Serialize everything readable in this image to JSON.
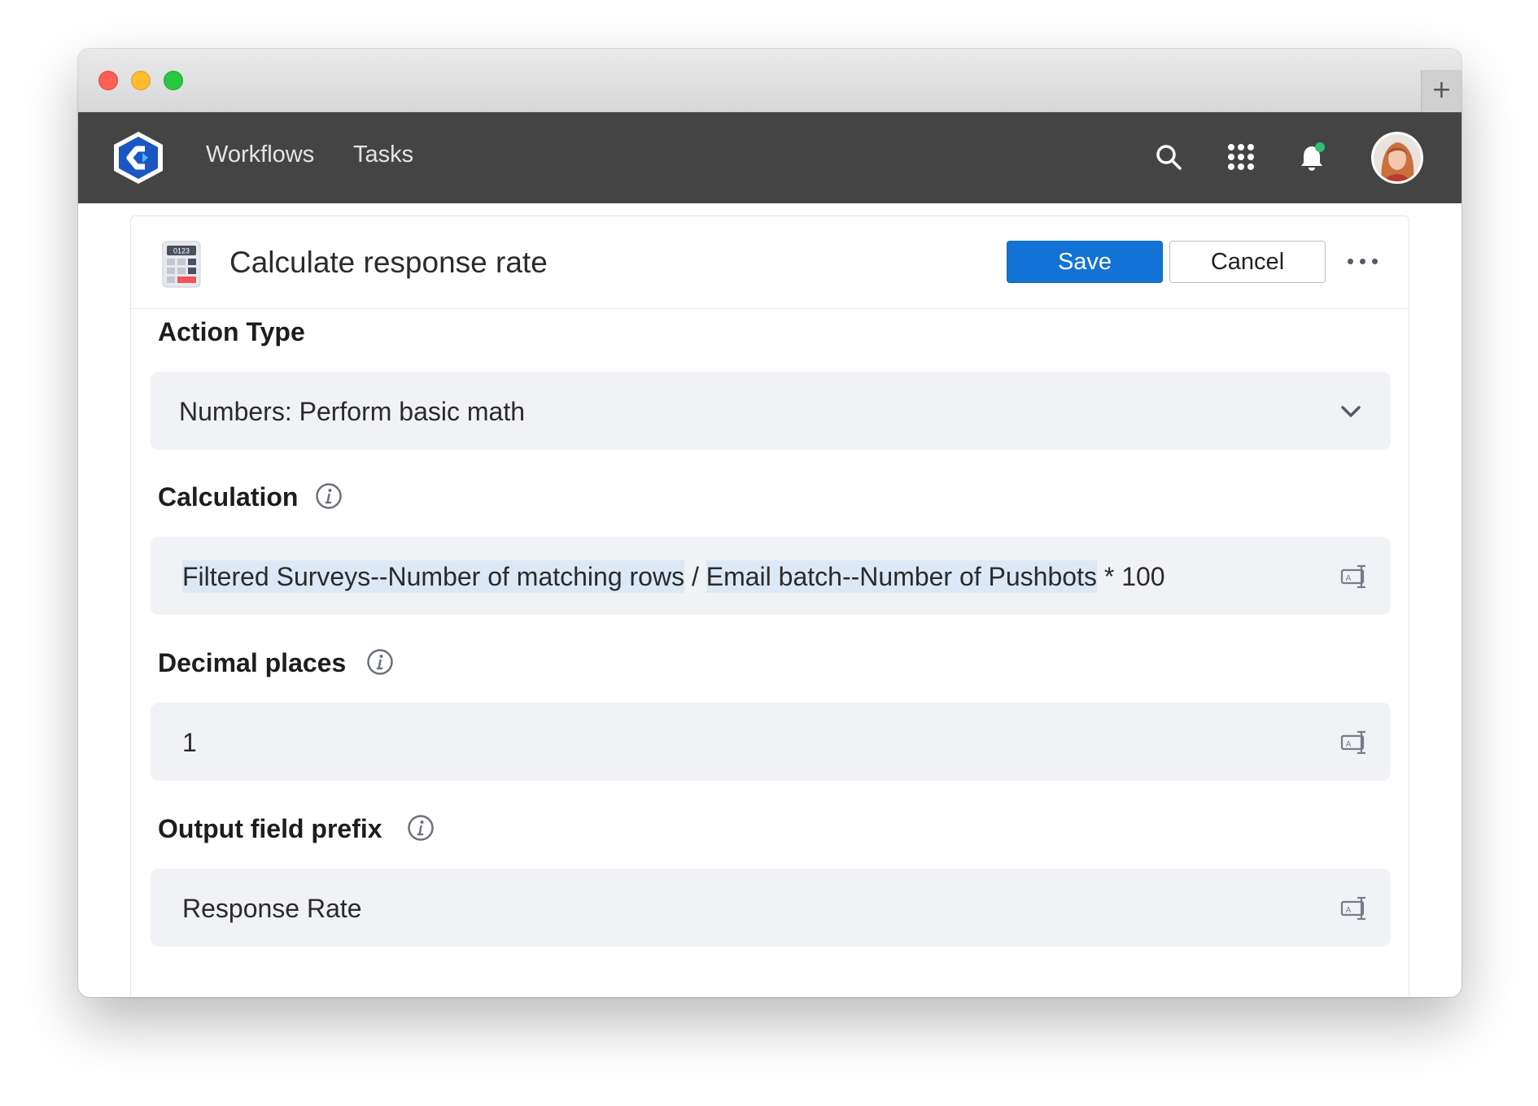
{
  "nav": {
    "links": [
      "Workflows",
      "Tasks"
    ],
    "new_tab_symbol": "+"
  },
  "header": {
    "title": "Calculate response rate",
    "save_label": "Save",
    "cancel_label": "Cancel",
    "more_icon": "ellipsis-icon"
  },
  "fields": {
    "action_type": {
      "label": "Action Type",
      "value": "Numbers: Perform basic math"
    },
    "calculation": {
      "label": "Calculation",
      "token1": "Filtered Surveys--Number of matching rows",
      "op1": " / ",
      "token2": "Email batch--Number of Pushbots",
      "rest": " * 100"
    },
    "decimal_places": {
      "label": "Decimal places",
      "value": "1"
    },
    "output_prefix": {
      "label": "Output field prefix",
      "value": "Response Rate"
    }
  },
  "colors": {
    "navbar": "#444444",
    "accent": "#1272d6",
    "field_bg": "#f1f2f6",
    "token_bg": "#dde8f6",
    "notification_dot": "#2fbf71"
  },
  "icons": [
    "logo-icon",
    "search-icon",
    "apps-grid-icon",
    "bell-icon",
    "avatar",
    "calculator-icon",
    "info-icon",
    "chevron-down-icon",
    "insert-field-icon"
  ]
}
